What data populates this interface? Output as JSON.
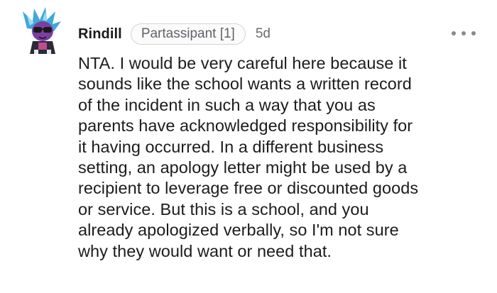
{
  "comment": {
    "author": "Rindill",
    "flair": "Partassipant [1]",
    "time": "5d",
    "more_icon": "more-horizontal-icon",
    "body": "NTA. I would be very careful here because it\nsounds like the school wants a written record\nof the incident in such a way that you as\nparents have acknowledged responsibility for\nit having occurred. In a different business\nsetting, an apology letter might be used by a\nrecipient to leverage free or discounted goods\nor service. But this is a school, and you\nalready apologized verbally, so I'm not sure\nwhy they would want or need that."
  },
  "colors": {
    "author": "#1a1a1b",
    "flair_border": "#d4d4d4",
    "meta": "#6b6b6b",
    "body": "#1c1c1c",
    "avatar_hair": "#3fa9d9",
    "avatar_skin": "#7a3fa0"
  }
}
